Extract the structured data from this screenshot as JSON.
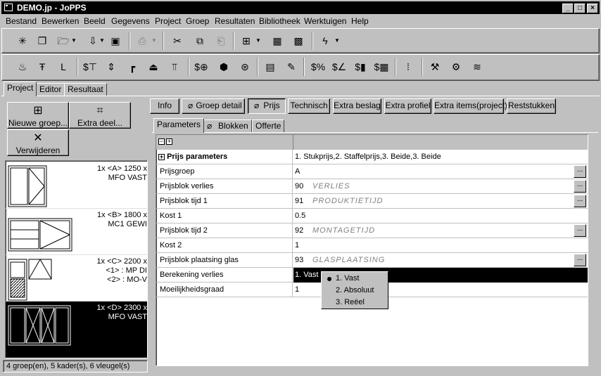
{
  "window": {
    "title": "DEMO.jp - JoPPS",
    "min": "_",
    "max": "□",
    "close": "×"
  },
  "menu": [
    "Bestand",
    "Bewerken",
    "Beeld",
    "Gegevens",
    "Project",
    "Groep",
    "Resultaten",
    "Bibliotheek",
    "Werktuigen",
    "Help"
  ],
  "toolbar1": [
    "new-icon",
    "copy-icon",
    "open-icon",
    "import-icon",
    "save-icon",
    "print-icon",
    "cut-icon",
    "paste-icon",
    "clipboard-icon",
    "grid-icon",
    "group-icon",
    "multi-icon",
    "lightning-icon"
  ],
  "toolbar2": [
    "profile-icon",
    "frame-icon",
    "sash-icon",
    "price-profile-icon",
    "dimension-icon",
    "corner-icon",
    "hinge-icon",
    "sill-icon",
    "price-hardware-icon",
    "glass-icon",
    "cylinder-icon",
    "sheet-icon",
    "notes-icon",
    "price-percent-icon",
    "price-graph-icon",
    "price-bars-icon",
    "price-table-icon",
    "height-icon",
    "tools-icon",
    "settings-icon",
    "spring-icon"
  ],
  "main_tabs": [
    "Project",
    "Editor",
    "Resultaat"
  ],
  "left": {
    "new_group": "Nieuwe groep...",
    "extra_part": "Extra deel...",
    "delete": "Verwijderen",
    "items": [
      {
        "line1": "1x <A> 1250 x",
        "line2": "MFO VAST"
      },
      {
        "line1": "1x <B> 1800 x",
        "line2": "MC1 GEWI"
      },
      {
        "line1": "1x <C> 2200 x",
        "line2": "<1> : MP DI",
        "line3": "<2> : MO-V"
      },
      {
        "line1": "1x <D> 2300 x",
        "line2": "MFO VAST"
      }
    ],
    "status": "4 groep(en), 5 kader(s), 6 vleugel(s)"
  },
  "top_buttons": [
    "Info",
    "Groep detail",
    "Prijs",
    "Technisch",
    "Extra beslag",
    "Extra profiel",
    "Extra items(project)",
    "Reststukken"
  ],
  "sub_tabs": [
    "Parameters",
    "Blokken",
    "Offerte"
  ],
  "grid": {
    "header_icons": [
      "collapse-icon",
      "expand-icon"
    ],
    "section": {
      "name": "Prijs parameters",
      "value": "1. Stukprijs,2. Staffelprijs,3. Beide,3. Beide"
    },
    "rows": [
      {
        "name": "Prijsgroep",
        "value": "A",
        "desc": "",
        "btn": "..."
      },
      {
        "name": "Prijsblok verlies",
        "value": "90",
        "desc": "VERLIES",
        "btn": "..."
      },
      {
        "name": "Prijsblok tijd 1",
        "value": "91",
        "desc": "PRODUKTIETIJD",
        "btn": "..."
      },
      {
        "name": "Kost 1",
        "value": "0.5",
        "desc": "",
        "btn": ""
      },
      {
        "name": "Prijsblok tijd 2",
        "value": "92",
        "desc": "MONTAGETIJD",
        "btn": "..."
      },
      {
        "name": "Kost 2",
        "value": "1",
        "desc": "",
        "btn": ""
      },
      {
        "name": "Prijsblok plaatsing glas",
        "value": "93",
        "desc": "GLASPLAATSING",
        "btn": "..."
      },
      {
        "name": "Berekening verlies",
        "value": "1. Vast",
        "desc": "",
        "btn": ""
      },
      {
        "name": "Moeilijkheidsgraad",
        "value": "1",
        "desc": "",
        "btn": ""
      }
    ]
  },
  "popup": [
    "1. Vast",
    "2. Absoluut",
    "3. Reëel"
  ]
}
